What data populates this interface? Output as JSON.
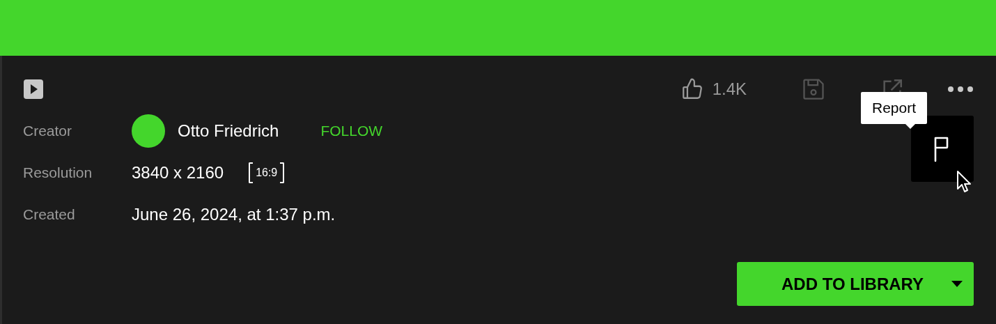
{
  "toolbar": {
    "likes": "1.4K",
    "save_disabled": true,
    "share_disabled": true
  },
  "report_popup": {
    "tooltip": "Report"
  },
  "details": [
    {
      "kind": "creator",
      "label": "Creator",
      "name": "Otto Friedrich",
      "action": "FOLLOW"
    },
    {
      "kind": "resolution",
      "label": "Resolution",
      "value": "3840 x 2160",
      "ratio": "16:9"
    },
    {
      "kind": "text",
      "label": "Created",
      "value": "June 26, 2024, at 1:37 p.m."
    }
  ],
  "primary_button": {
    "label": "ADD TO LIBRARY"
  }
}
